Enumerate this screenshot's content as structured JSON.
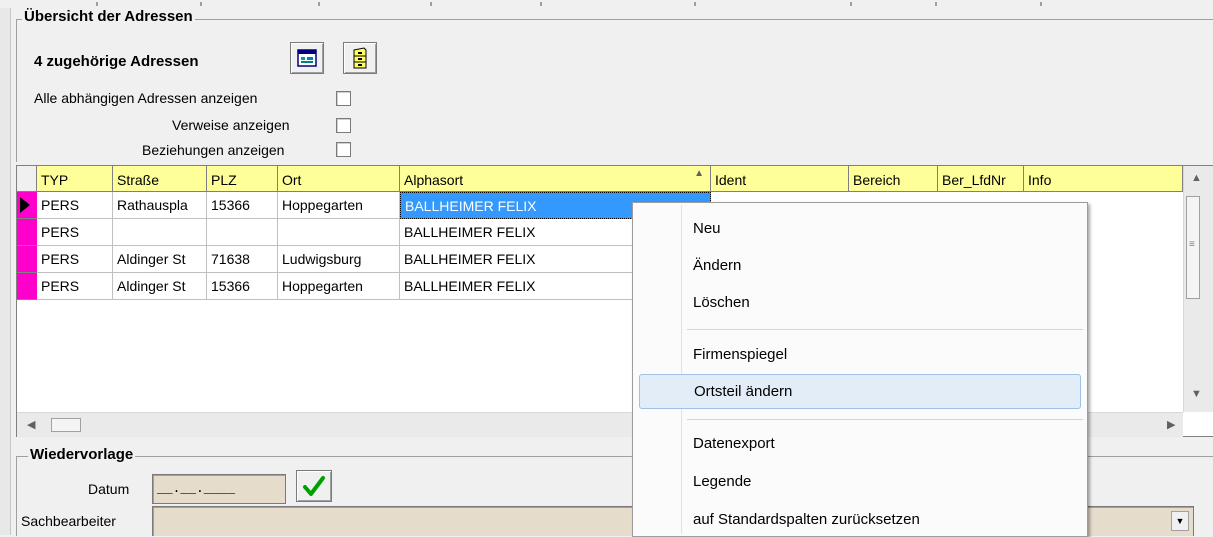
{
  "overview": {
    "title": "Übersicht der Adressen",
    "count_label": "4 zugehörige Adressen",
    "opt_all_dependent": "Alle abhängigen Adressen anzeigen",
    "opt_references": "Verweise anzeigen",
    "opt_relations": "Beziehungen anzeigen"
  },
  "grid": {
    "columns": [
      "TYP",
      "Straße",
      "PLZ",
      "Ort",
      "Alphasort",
      "Ident",
      "Bereich",
      "Ber_LfdNr",
      "Info"
    ],
    "sort_indicator": "▲",
    "rows": [
      {
        "typ": "PERS",
        "strasse": "Rathauspla",
        "plz": "15366",
        "ort": "Hoppegarten",
        "alphasort": "BALLHEIMER FELIX"
      },
      {
        "typ": "PERS",
        "strasse": "",
        "plz": "",
        "ort": "",
        "alphasort": "BALLHEIMER FELIX"
      },
      {
        "typ": "PERS",
        "strasse": "Aldinger St",
        "plz": "71638",
        "ort": "Ludwigsburg",
        "alphasort": "BALLHEIMER FELIX"
      },
      {
        "typ": "PERS",
        "strasse": "Aldinger St",
        "plz": "15366",
        "ort": "Hoppegarten",
        "alphasort": "BALLHEIMER FELIX"
      }
    ],
    "row_marker_color": "#ff00cc",
    "header_color": "#ffff99",
    "selection_color": "#3399ff"
  },
  "resubmission": {
    "title": "Wiedervorlage",
    "date_label": "Datum",
    "date_value": "__.__.____",
    "clerk_label": "Sachbearbeiter"
  },
  "context_menu": {
    "items": [
      "Neu",
      "Ändern",
      "Löschen",
      "Firmenspiegel",
      "Ortsteil ändern",
      "Datenexport",
      "Legende",
      "auf Standardspalten zurücksetzen"
    ],
    "highlighted": "Ortsteil ändern"
  },
  "icons": {
    "view_button": "calendar-window-icon",
    "other_button": "cabinet-icon",
    "confirm": "checkmark-icon"
  }
}
